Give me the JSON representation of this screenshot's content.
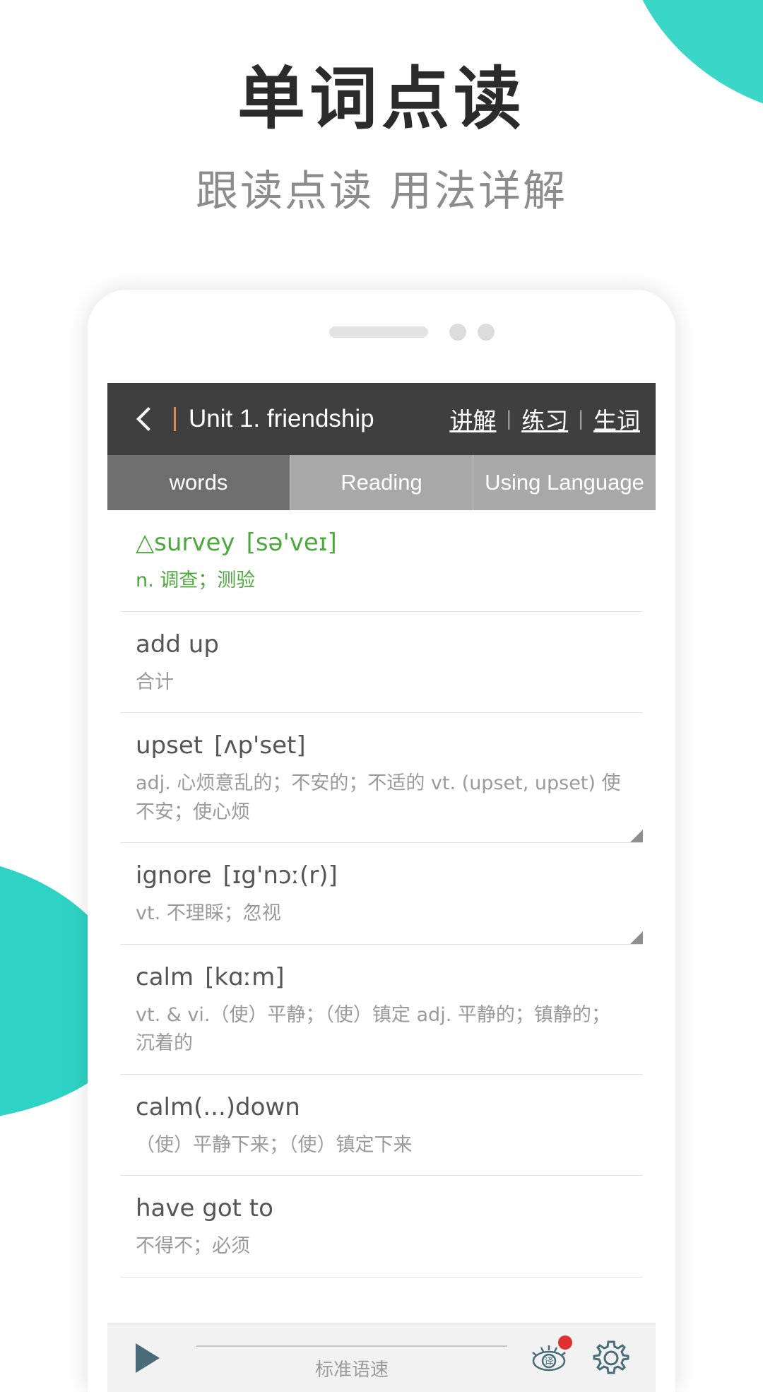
{
  "poster": {
    "headline": "单词点读",
    "subhead": "跟读点读 用法详解",
    "accent_color": "#3ad6c8"
  },
  "app": {
    "titlebar": {
      "back_icon": "chevron-left-icon",
      "unit_title": "Unit 1. friendship",
      "links": [
        "讲解",
        "练习",
        "生词"
      ],
      "separator": "|"
    },
    "tabs": [
      {
        "label": "words",
        "selected": true
      },
      {
        "label": "Reading",
        "selected": false
      },
      {
        "label": "Using Language",
        "selected": false
      }
    ],
    "words": [
      {
        "marker": "△",
        "word": "survey",
        "phonetic": "[sə'veɪ]",
        "definition": "n. 调查；测验",
        "highlight": true,
        "corner": false
      },
      {
        "marker": "",
        "word": "add up",
        "phonetic": "",
        "definition": "合计",
        "highlight": false,
        "corner": false
      },
      {
        "marker": "",
        "word": "upset",
        "phonetic": "[ʌp'set]",
        "definition": "adj. 心烦意乱的；不安的；不适的 vt. (upset, upset) 使不安；使心烦",
        "highlight": false,
        "corner": true
      },
      {
        "marker": "",
        "word": "ignore",
        "phonetic": "[ɪg'nɔː(r)]",
        "definition": "vt. 不理睬；忽视",
        "highlight": false,
        "corner": true
      },
      {
        "marker": "",
        "word": "calm",
        "phonetic": "[kɑːm]",
        "definition": "vt. & vi.（使）平静；（使）镇定 adj. 平静的；镇静的；沉着的",
        "highlight": false,
        "corner": false
      },
      {
        "marker": "",
        "word": "calm(...)down",
        "phonetic": "",
        "definition": "（使）平静下来；（使）镇定下来",
        "highlight": false,
        "corner": false
      },
      {
        "marker": "",
        "word": "have got to",
        "phonetic": "",
        "definition": "不得不；必须",
        "highlight": false,
        "corner": false
      }
    ],
    "player": {
      "play_icon": "play-icon",
      "speed_label": "标准语速",
      "translate_icon": "eye-translate-icon",
      "translate_badge": true,
      "settings_icon": "gear-icon"
    }
  }
}
